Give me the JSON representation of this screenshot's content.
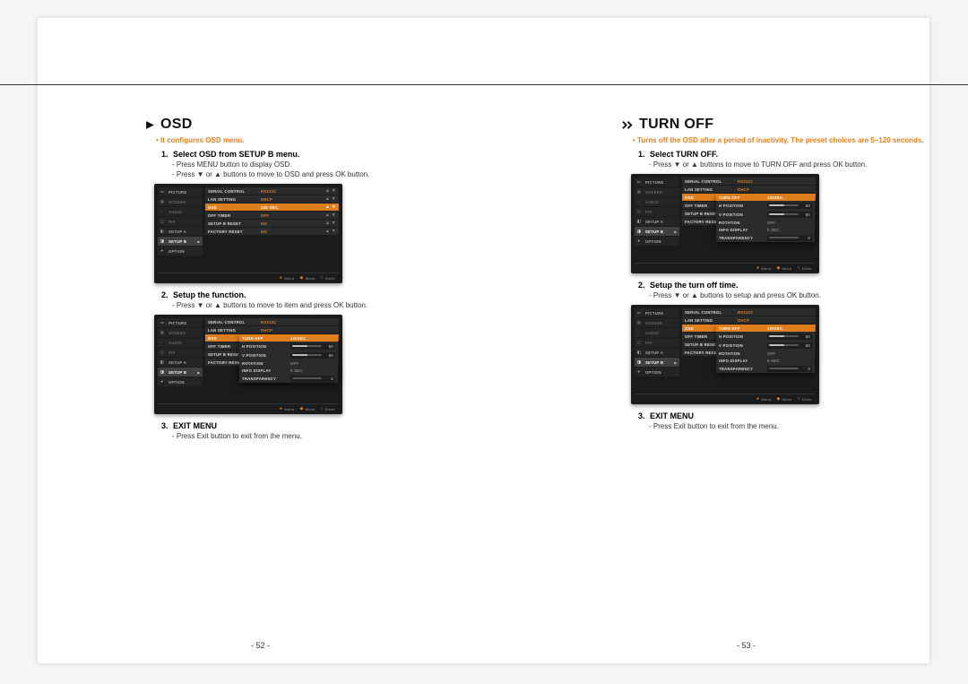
{
  "left": {
    "title": "OSD",
    "intro": "It configures OSD menu.",
    "step1_n": "1.",
    "step1": "Select OSD from SETUP B menu.",
    "step1a": "Press MENU button to display OSD.",
    "step1b": "Press ▼ or ▲ buttons to move to OSD and press OK button.",
    "step2_n": "2.",
    "step2": "Setup the function.",
    "step2a": "Press ▼ or ▲ buttons to move to item and press OK button.",
    "step3_n": "3.",
    "step3": "EXIT MENU",
    "step3a": "Press Exit button to exit from the menu."
  },
  "right": {
    "title": "TURN OFF",
    "intro": "Turns off the OSD after a period of inactivity. The preset choices are 5~120 seconds.",
    "step1_n": "1.",
    "step1": "Select TURN OFF.",
    "step1a": "Press ▼ or ▲ buttons to move to TURN OFF and press OK button.",
    "step2_n": "2.",
    "step2": "Setup the turn off time.",
    "step2a": "Press ▼ or ▲ buttons to setup and press OK button.",
    "step3_n": "3.",
    "step3": "EXIT MENU",
    "step3a": "Press Exit button to exit from the menu."
  },
  "nav": {
    "picture": "PICTURE",
    "screen": "SCREEN",
    "audio": "AUDIO",
    "pip": "PIP",
    "setup_a": "SETUP A",
    "setup_b": "SETUP B",
    "option": "OPTION",
    "setup_b_arrow": "▸"
  },
  "rows": {
    "serial": "SERIAL CONTROL",
    "serial_v": "RS232C",
    "lan": "LAN SETTING",
    "lan_v": "DHCP",
    "osd": "OSD",
    "osd_v": "120 SEC.",
    "timer": "OFF TIMER",
    "timer_v": "OFF",
    "sbreset": "SETUP B RESET",
    "no": "NO",
    "freset": "FACTORY RESET",
    "updown": "▲\n▼"
  },
  "sub": {
    "turnoff": "TURN OFF",
    "turnoff_v": "120SEC.",
    "hpos": "H POSITION",
    "hpos_v": "50",
    "vpos": "V POSITION",
    "vpos_v": "50",
    "rot": "ROTATION",
    "rot_v": "OFF",
    "info": "INFO DISPLAY",
    "info_v": "5 SEC.",
    "trans": "TRANSPARENCY",
    "trans_v": "0"
  },
  "footer": {
    "menu": "Menu",
    "move": "Move",
    "enter": "Enter",
    "dot": "●",
    "dia": "◆",
    "circ": "○"
  },
  "pagenum_l": "- 52 -",
  "pagenum_r": "- 53 -"
}
